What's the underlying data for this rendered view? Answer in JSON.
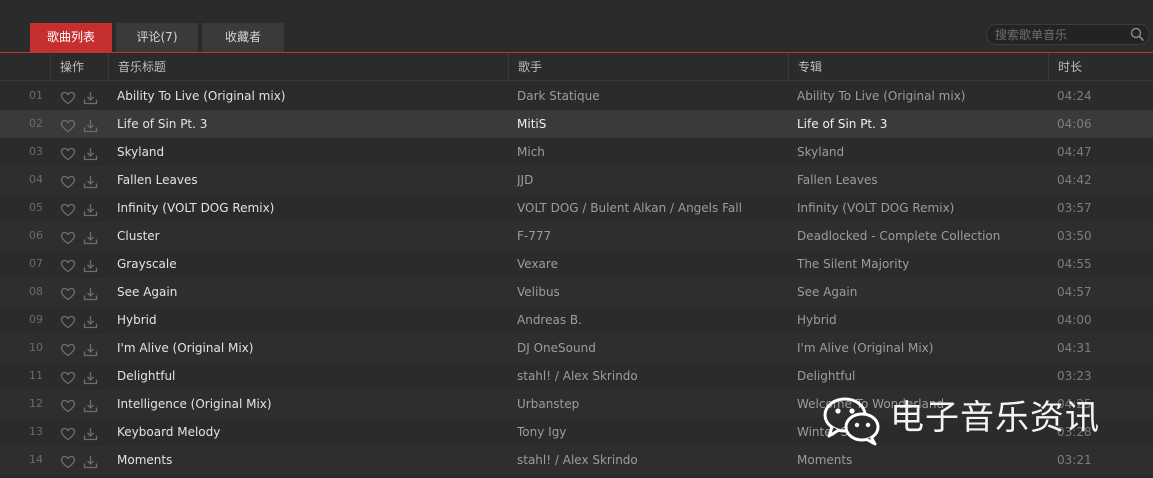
{
  "tabs": [
    {
      "label": "歌曲列表",
      "active": true
    },
    {
      "label": "评论(7)",
      "active": false
    },
    {
      "label": "收藏者",
      "active": false
    }
  ],
  "search": {
    "placeholder": "搜索歌单音乐",
    "icon": "search-icon"
  },
  "columns": {
    "ops": "操作",
    "title": "音乐标题",
    "artist": "歌手",
    "album": "专辑",
    "duration": "时长"
  },
  "colors": {
    "accent": "#c62f2f",
    "background": "#2b2b2b",
    "selected_row": "#3a3a3a"
  },
  "selected_index": 1,
  "songs": [
    {
      "num": "01",
      "title": "Ability To Live (Original mix)",
      "artist": "Dark Statique",
      "album": "Ability To Live (Original mix)",
      "duration": "04:24"
    },
    {
      "num": "02",
      "title": "Life of Sin Pt. 3",
      "artist": "MitiS",
      "album": "Life of Sin Pt. 3",
      "duration": "04:06"
    },
    {
      "num": "03",
      "title": "Skyland",
      "artist": "Mich",
      "album": "Skyland",
      "duration": "04:47"
    },
    {
      "num": "04",
      "title": "Fallen Leaves",
      "artist": "JJD",
      "album": "Fallen Leaves",
      "duration": "04:42"
    },
    {
      "num": "05",
      "title": "Infinity (VOLT DOG Remix)",
      "artist": "VOLT DOG / Bulent Alkan / Angels Fall",
      "album": "Infinity (VOLT DOG Remix)",
      "duration": "03:57"
    },
    {
      "num": "06",
      "title": "Cluster",
      "artist": "F-777",
      "album": "Deadlocked - Complete Collection",
      "duration": "03:50"
    },
    {
      "num": "07",
      "title": "Grayscale",
      "artist": "Vexare",
      "album": "The Silent Majority",
      "duration": "04:55"
    },
    {
      "num": "08",
      "title": "See Again",
      "artist": "Velibus",
      "album": "See Again",
      "duration": "04:57"
    },
    {
      "num": "09",
      "title": "Hybrid",
      "artist": "Andreas B.",
      "album": "Hybrid",
      "duration": "04:00"
    },
    {
      "num": "10",
      "title": "I'm Alive (Original Mix)",
      "artist": "DJ OneSound",
      "album": "I'm Alive (Original Mix)",
      "duration": "04:31"
    },
    {
      "num": "11",
      "title": "Delightful",
      "artist": "stahl! / Alex Skrindo",
      "album": "Delightful",
      "duration": "03:23"
    },
    {
      "num": "12",
      "title": "Intelligence (Original Mix)",
      "artist": "Urbanstep",
      "album": "Welcome To Wonderland",
      "duration": "04:25"
    },
    {
      "num": "13",
      "title": "Keyboard Melody",
      "artist": "Tony Igy",
      "album": "Winter Sun",
      "duration": "03:28"
    },
    {
      "num": "14",
      "title": "Moments",
      "artist": "stahl! / Alex Skrindo",
      "album": "Moments",
      "duration": "03:21"
    }
  ],
  "watermark": {
    "text": "电子音乐资讯",
    "icon": "wechat-logo-icon"
  }
}
